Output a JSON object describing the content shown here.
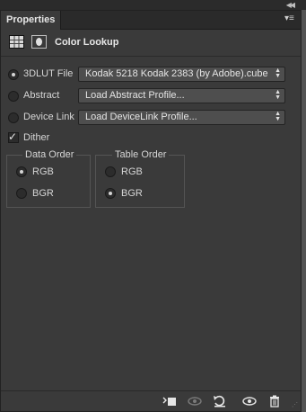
{
  "panel": {
    "tab_label": "Properties",
    "title": "Color Lookup"
  },
  "lookup": {
    "file_3dlut": {
      "label": "3DLUT File",
      "value": "Kodak 5218 Kodak 2383 (by Adobe).cube",
      "selected": true
    },
    "abstract": {
      "label": "Abstract",
      "value": "Load Abstract Profile...",
      "selected": false
    },
    "device_link": {
      "label": "Device Link",
      "value": "Load DeviceLink Profile...",
      "selected": false
    },
    "dither": {
      "label": "Dither",
      "checked": true
    }
  },
  "data_order": {
    "title": "Data Order",
    "options": [
      {
        "label": "RGB",
        "selected": true
      },
      {
        "label": "BGR",
        "selected": false
      }
    ]
  },
  "table_order": {
    "title": "Table Order",
    "options": [
      {
        "label": "RGB",
        "selected": false
      },
      {
        "label": "BGR",
        "selected": true
      }
    ]
  },
  "icons": {
    "lookup_adjustment": "grid-table-icon",
    "mask": "layer-mask-icon",
    "clip": "clip-to-layer-icon",
    "view_previous": "view-previous-state-icon",
    "reset": "reset-icon",
    "visibility": "eye-icon",
    "delete": "trash-icon"
  }
}
